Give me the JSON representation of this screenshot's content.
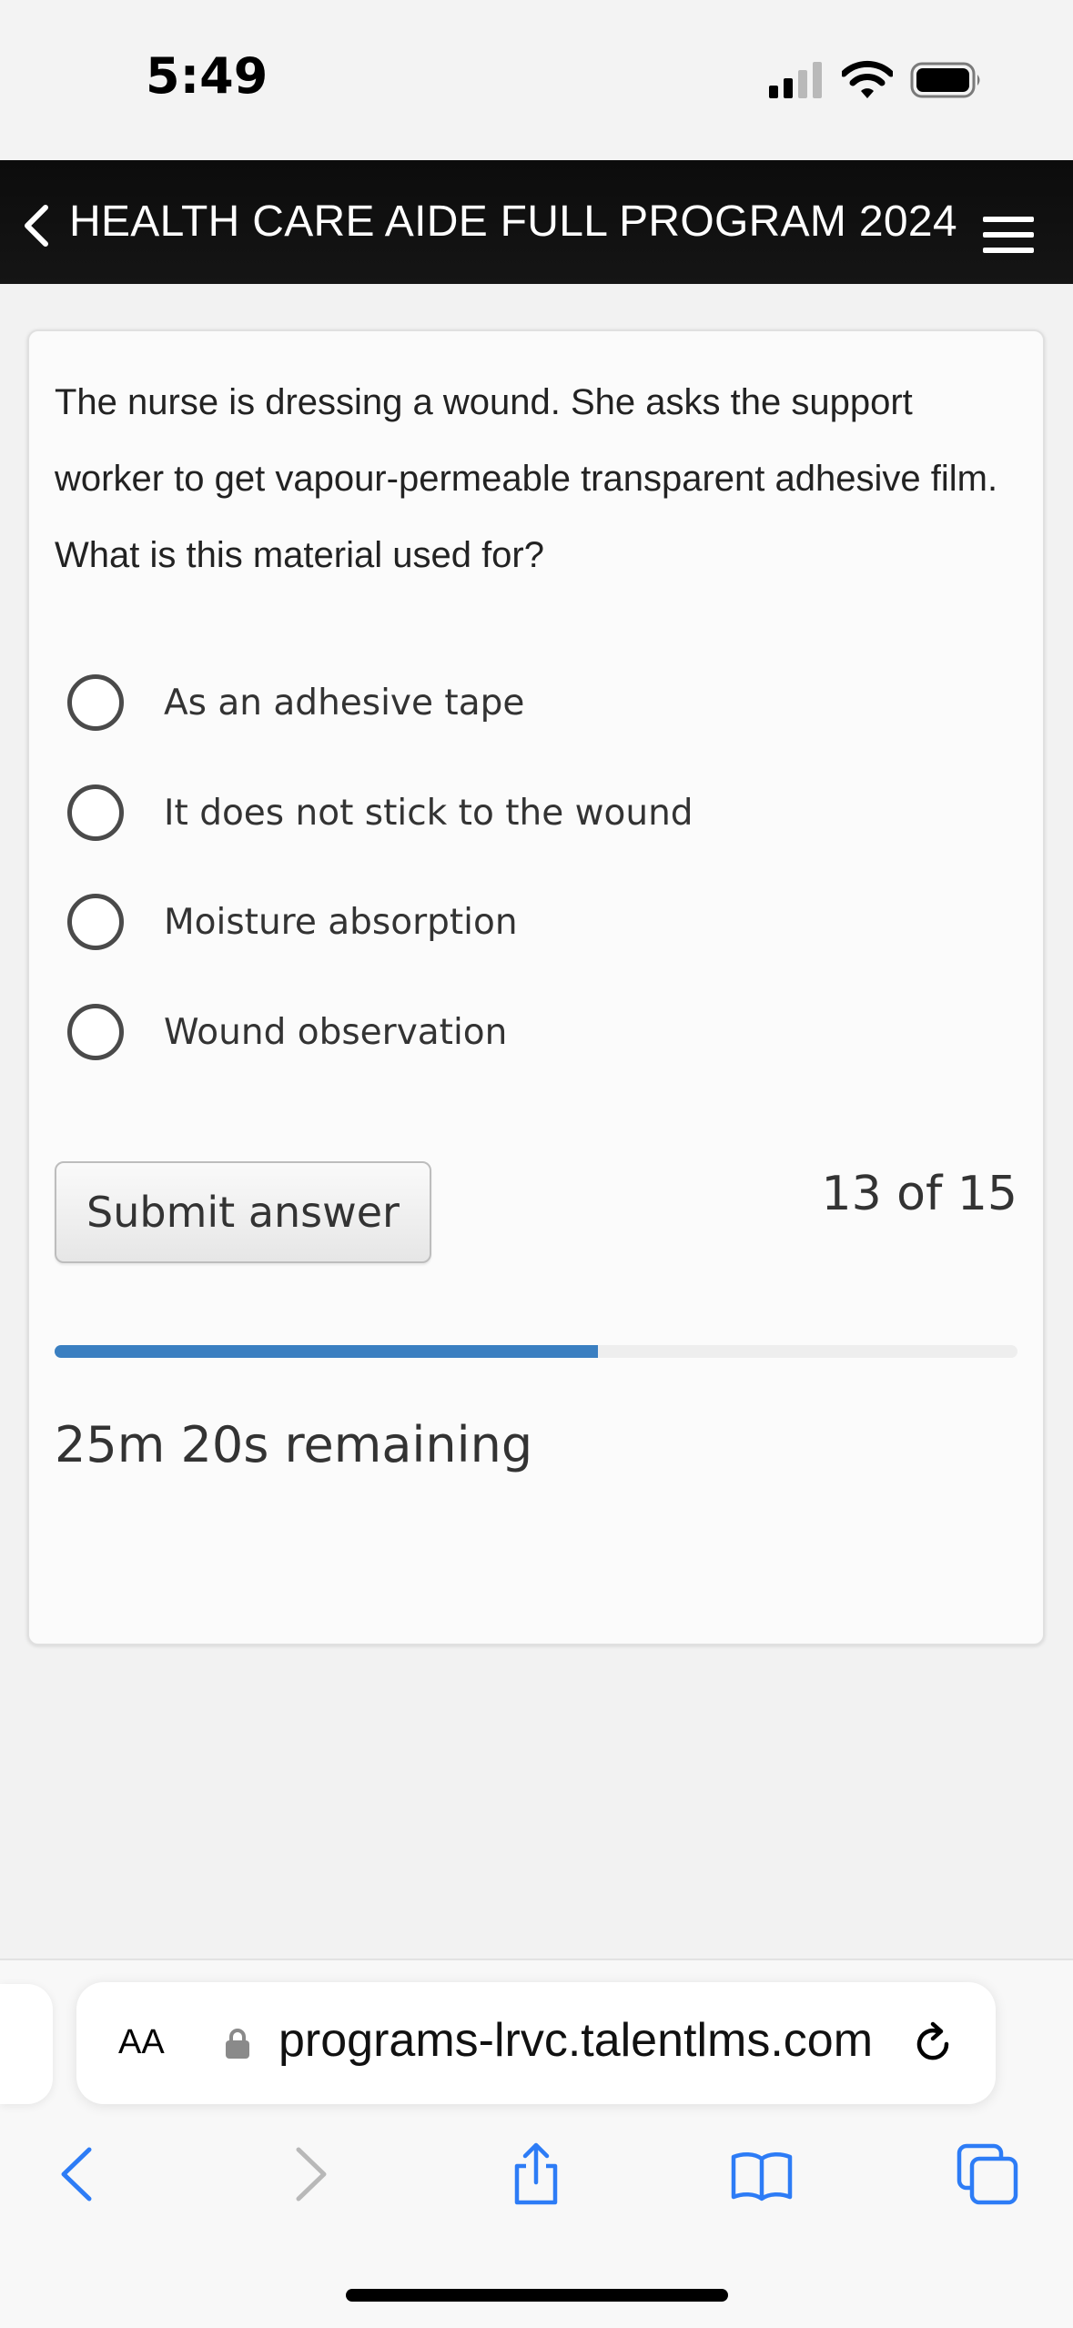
{
  "status_bar": {
    "time": "5:49"
  },
  "header": {
    "title": "HEALTH CARE AIDE FULL PROGRAM 2024"
  },
  "quiz": {
    "question": "The nurse is dressing a wound. She asks the support worker to get vapour-permeable transparent adhesive film. What is this material used for?",
    "options": [
      "As an adhesive tape",
      "It does not stick to the wound",
      "Moisture absorption",
      "Wound observation"
    ],
    "submit_label": "Submit answer",
    "counter": "13 of 15",
    "progress_percent": 56.4,
    "remaining": "25m 20s remaining"
  },
  "browser": {
    "aa_label": "AA",
    "url": "programs-lrvc.talentlms.com"
  },
  "colors": {
    "accent": "#3a7fc1",
    "header_bg": "#111111",
    "ios_blue": "#2d7cf6"
  },
  "icons": [
    "signal-icon",
    "wifi-icon",
    "battery-icon",
    "back-chevron-icon",
    "menu-icon",
    "lock-icon",
    "reload-icon",
    "back-icon",
    "forward-icon",
    "share-icon",
    "bookmarks-icon",
    "tabs-icon"
  ]
}
